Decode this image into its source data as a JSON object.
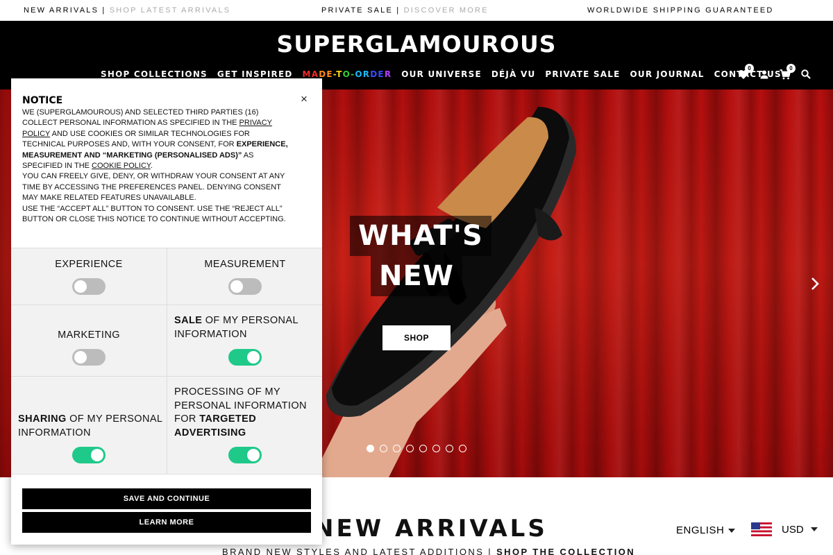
{
  "announcement": {
    "left_main": "NEW ARRIVALS",
    "left_link": "SHOP LATEST ARRIVALS",
    "center_main": "PRIVATE SALE",
    "center_link": "DISCOVER MORE",
    "right": "WORLDWIDE SHIPPING GUARANTEED",
    "separator": "|"
  },
  "header": {
    "logo": "SUPERGLAMOUROUS",
    "nav": [
      "SHOP COLLECTIONS",
      "GET INSPIRED",
      "MADE-TO-ORDER",
      "OUR UNIVERSE",
      "DÉJÀ VU",
      "PRIVATE SALE",
      "OUR JOURNAL",
      "CONTACT US"
    ],
    "rainbow_colors": [
      "#ff2a2a",
      "#ff8c1a",
      "#f5d31a",
      "#2fd12f",
      "#1ab8ff",
      "#3a4bff",
      "#b33cff"
    ],
    "wishlist_count": "0",
    "cart_count": "0",
    "icons": [
      "heart-icon",
      "user-icon",
      "cart-icon",
      "search-icon"
    ]
  },
  "hero": {
    "title_line1": "WHAT'S",
    "title_line2": "NEW",
    "cta": "SHOP",
    "slide_count": 8,
    "active_slide": 1
  },
  "section": {
    "title": "NEW ARRIVALS",
    "subtitle": "BRAND NEW STYLES AND LATEST ADDITIONS",
    "subtitle_sep": "|",
    "subtitle_link": "SHOP THE COLLECTION"
  },
  "locale": {
    "language": "ENGLISH",
    "currency": "USD"
  },
  "cookie": {
    "title": "NOTICE",
    "close": "×",
    "p1_a": "We (Superglamourous) and selected third parties (16) collect personal information as specified in the ",
    "privacy_link": "privacy policy",
    "p1_b": " and use cookies or similar technologies for technical purposes and, with your consent, for ",
    "p1_bold": "experience, measurement and “marketing (personalised ads)”",
    "p1_c": " as specified in the ",
    "cookie_link": "cookie policy",
    "p1_d": ".",
    "p2": "You can freely give, deny, or withdraw your consent at any time by accessing the preferences panel. Denying consent may make related features unavailable.",
    "p3": "Use the “Accept all” button to consent. Use the “Reject all” button or close this notice to continue without accepting.",
    "options": {
      "experience": {
        "label": "EXPERIENCE",
        "on": false
      },
      "measurement": {
        "label": "MEASUREMENT",
        "on": false
      },
      "marketing": {
        "label": "MARKETING",
        "on": false
      },
      "sale": {
        "bold": "SALE",
        "rest": " OF MY PERSONAL INFORMATION",
        "on": true
      },
      "sharing": {
        "bold": "SHARING",
        "rest": " OF MY PERSONAL INFORMATION",
        "on": true
      },
      "targeted": {
        "pre": "PROCESSING OF MY PERSONAL INFORMATION FOR ",
        "bold": "TARGETED ADVERTISING",
        "on": true
      }
    },
    "save_button": "SAVE AND CONTINUE",
    "learn_button": "LEARN MORE"
  },
  "colors": {
    "toggle_on": "#1fc98a",
    "toggle_off": "#bcbcbc",
    "hero_red": "#c51a14"
  }
}
